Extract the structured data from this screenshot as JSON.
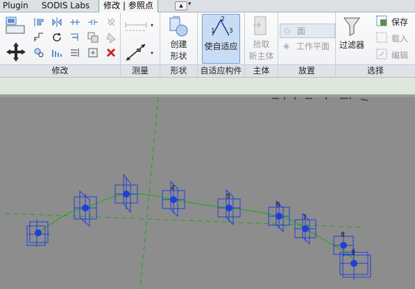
{
  "tabs": {
    "plugin": "Plugin",
    "sodis": "SODIS Labs",
    "modify": "修改 | 参照点"
  },
  "panels": {
    "modify": "修改",
    "measure": "测量",
    "shape": "形状",
    "adaptive": "自适应构件",
    "host": "主体",
    "place": "放置",
    "select": "选择"
  },
  "buttons": {
    "create_form_line1": "创建",
    "create_form_line2": "形状",
    "make_adaptive": "使自适应",
    "pick_host_line1": "拾取",
    "pick_host_line2": "新主体",
    "place_face": "面",
    "place_workplane": "工作平面",
    "filter": "过滤器",
    "save": "保存",
    "load": "载入",
    "edit": "编辑"
  },
  "canvas": {
    "point_labels": [
      "4",
      "5",
      "6",
      "7",
      "8",
      "9"
    ]
  },
  "colors": {
    "accent_green": "#7fb85e",
    "point_blue": "#1f3fd6",
    "curve_green": "#22aa22",
    "canvas_bg": "#8d8d8d"
  }
}
